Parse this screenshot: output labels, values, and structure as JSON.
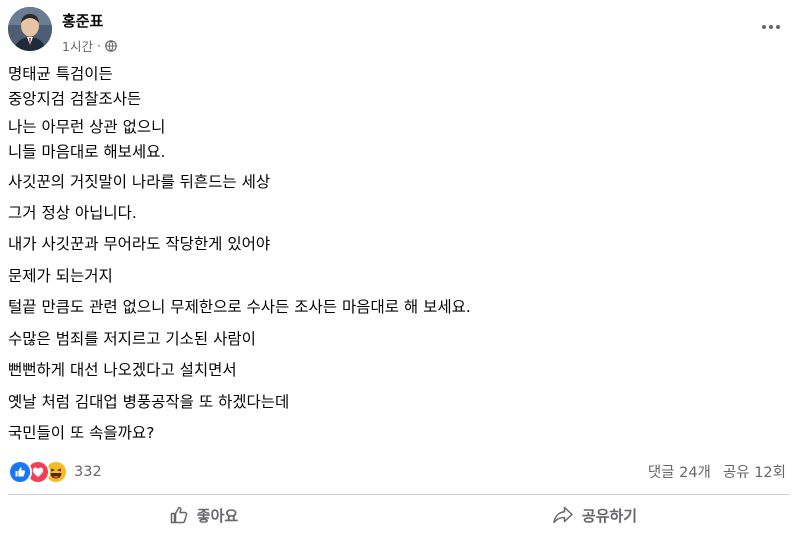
{
  "post": {
    "author": "홍준표",
    "time": "1시간",
    "privacy_icon": "globe-icon",
    "lines": [
      "명태균 특검이든",
      "중앙지검 검찰조사든",
      "나는 아무런 상관 없으니",
      "니들 마음대로 해보세요.",
      "사깃꾼의 거짓말이 나라를 뒤흔드는 세상",
      "그거 정상 아닙니다.",
      "내가 사깃꾼과 무어라도 작당한게 있어야",
      "문제가 되는거지",
      "털끝 만큼도  관련 없으니 무제한으로 수사든 조사든 마음대로 해 보세요.",
      "수많은 범죄를 저지르고 기소된 사람이",
      "뻔뻔하게 대선 나오겠다고 설치면서",
      "옛날 처럼 김대업 병풍공작을 또 하겠다는데",
      "국민들이 또 속을까요?"
    ]
  },
  "stats": {
    "reaction_icons": [
      "like-icon",
      "love-icon",
      "haha-icon"
    ],
    "reaction_count": "332",
    "comments": "댓글 24개",
    "shares": "공유 12회"
  },
  "actions": {
    "like_label": "좋아요",
    "share_label": "공유하기"
  },
  "colors": {
    "like": "#1877f2",
    "love": "#f33e58",
    "haha": "#f7b928",
    "muted_text": "#65676b"
  }
}
